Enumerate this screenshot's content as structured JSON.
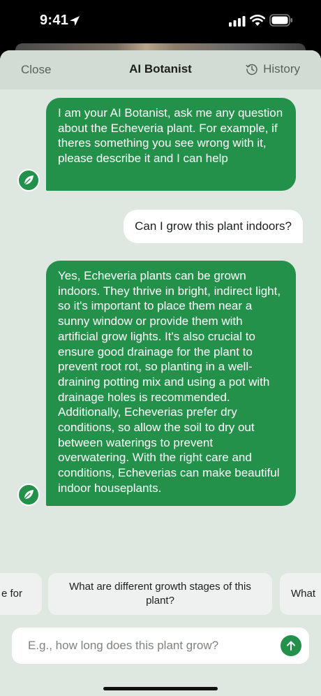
{
  "status_bar": {
    "time": "9:41"
  },
  "nav": {
    "close_label": "Close",
    "title": "AI Botanist",
    "history_label": "History"
  },
  "messages": [
    {
      "role": "bot",
      "text": "I am your AI Botanist, ask me any question about the Echeveria plant. For example, if theres something you see wrong with it, please describe it and I can help"
    },
    {
      "role": "user",
      "text": "Can I grow this plant indoors?"
    },
    {
      "role": "bot",
      "text": "Yes, Echeveria plants can be grown indoors. They thrive in bright, indirect light, so it's important to place them near a sunny window or provide them with artificial grow lights. It's also crucial to ensure good drainage for the plant to prevent root rot, so planting in a well-draining potting mix and using a pot with drainage holes is recommended. Additionally, Echeverias prefer dry conditions, so allow the soil to dry out between waterings to prevent overwatering. With the right care and conditions, Echeverias can make beautiful indoor houseplants."
    }
  ],
  "suggestions": [
    "e for",
    "What are different growth stages of this plant?",
    "What"
  ],
  "input": {
    "placeholder": "E.g., how long does this plant grow?"
  },
  "colors": {
    "accent": "#24914b",
    "sheet_bg": "#dfe7e1",
    "nav_bg": "#d2dcd5"
  },
  "icons": {
    "status": [
      "location-arrow-icon",
      "signal-icon",
      "wifi-icon",
      "battery-icon"
    ],
    "history": "clock-history-icon",
    "avatar": "leaf-icon",
    "send": "arrow-up-icon"
  }
}
